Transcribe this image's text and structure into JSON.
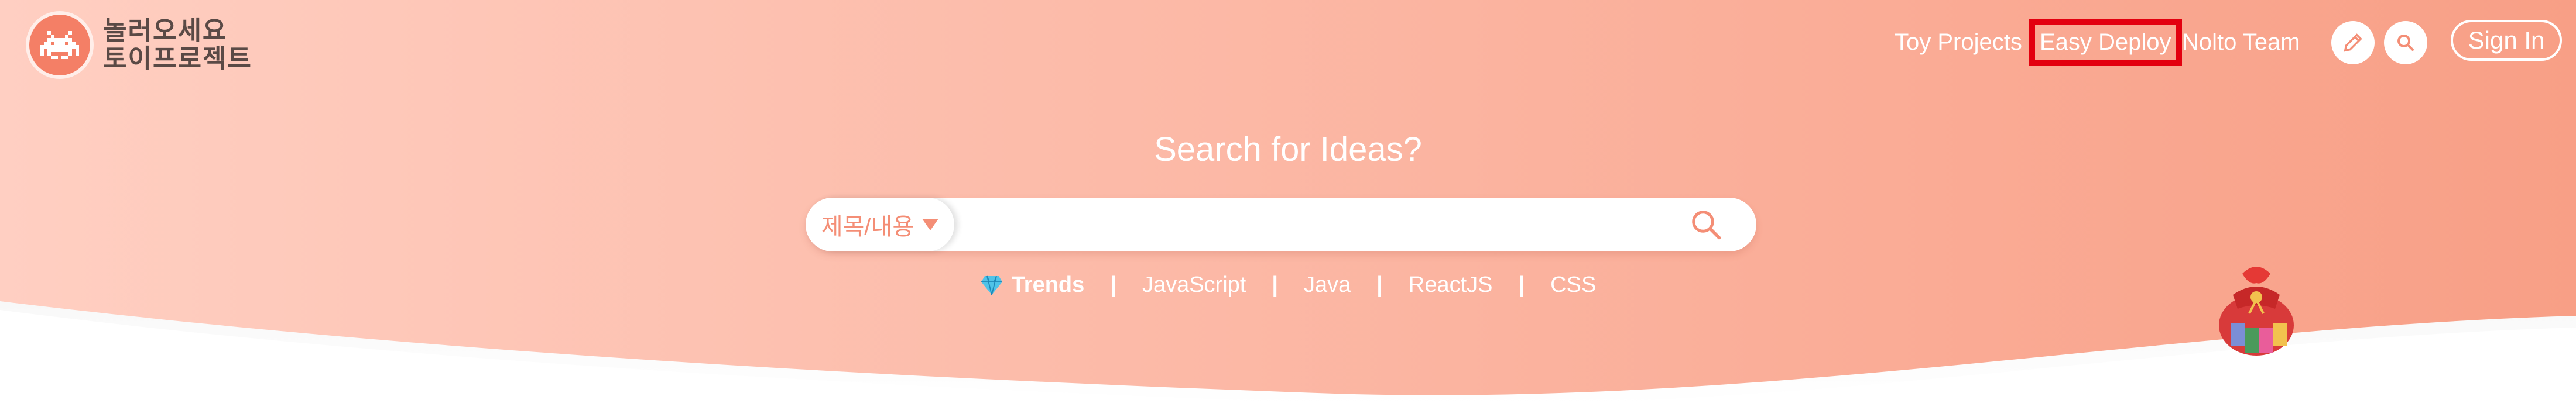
{
  "logo": {
    "line1": "놀러오세요",
    "line2": "토이프로젝트",
    "icon": "space-invader-icon"
  },
  "nav": {
    "links": [
      "Toy Projects",
      "Easy Deploy",
      "Nolto Team"
    ],
    "write_icon": "pencil-icon",
    "search_icon": "search-icon",
    "signin": "Sign In"
  },
  "hero": {
    "headline": "Search for Ideas?",
    "select_value": "제목/내용",
    "search_value": "",
    "trends_label": "Trends",
    "trends_icon": "diamond-icon",
    "tags": [
      "JavaScript",
      "Java",
      "ReactJS",
      "CSS"
    ],
    "separator": "|"
  },
  "colors": {
    "gradient_left": "#ffcfc2",
    "gradient_right": "#f89f86",
    "accent": "#f48e76",
    "highlight_box": "#e3000f"
  }
}
